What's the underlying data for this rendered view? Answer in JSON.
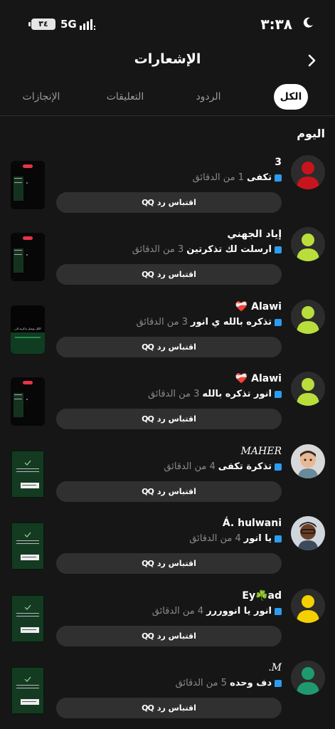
{
  "status_bar": {
    "time": "٣:٣٨",
    "network": "5G",
    "battery": "٣٤"
  },
  "header": {
    "title": "الإشعارات"
  },
  "tabs": [
    {
      "label": "الكل",
      "active": true
    },
    {
      "label": "الردود",
      "active": false
    },
    {
      "label": "التعليقات",
      "active": false
    },
    {
      "label": "الإنجازات",
      "active": false
    }
  ],
  "section_title": "اليوم",
  "reply_label": "اقتباس رد",
  "notifications": [
    {
      "name": "3",
      "message": "تكفى",
      "time": "1 من الدقائق",
      "avatar_color": "#c8141c"
    },
    {
      "name": "إياد الجهني",
      "message": "ارسلت لك تذكرتين",
      "time": "3 من الدقائق",
      "avatar_color": "#b9de3c"
    },
    {
      "name": "Alawi ❤️‍🩹",
      "message": "تذكره بالله ي انور",
      "time": "3 من الدقائق",
      "avatar_color": "#b9de3c"
    },
    {
      "name": "Alawi ❤️‍🩹",
      "message": "انور تذكره بالله",
      "time": "3 من الدقائق",
      "avatar_color": "#b9de3c"
    },
    {
      "name": "MAHER",
      "message": "تذكرة تكفى",
      "time": "4 من الدقائق",
      "avatar_color": "#e3e3e3"
    },
    {
      "name": "Á. hulwani",
      "message": "يا انور",
      "time": "4 من الدقائق",
      "avatar_color": "#5a3a2a"
    },
    {
      "name": "Ey☘️ad",
      "message": "انور يا انووررر",
      "time": "4 من الدقائق",
      "avatar_color": "#f4d000"
    },
    {
      "name": "M.",
      "message": "دف وحده",
      "time": "5 من الدقائق",
      "avatar_color": "#1f9a6e"
    }
  ],
  "thumbnail_text": "الكل يوصل تذكرته الى"
}
